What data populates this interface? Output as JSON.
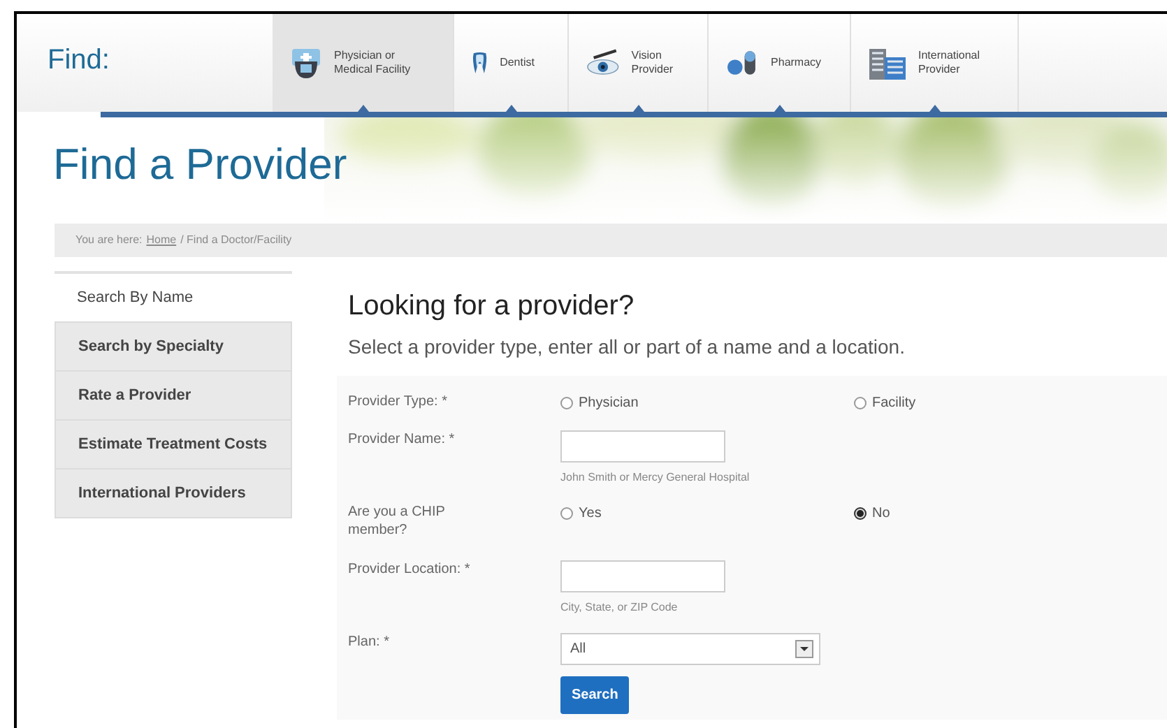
{
  "header": {
    "label": "Find:"
  },
  "provider_tabs": [
    {
      "label": "Physician or Medical Facility",
      "kind": "physician",
      "selected": true
    },
    {
      "label": "Dentist",
      "kind": "dentist",
      "selected": false
    },
    {
      "label": "Vision Provider",
      "kind": "vision",
      "selected": false
    },
    {
      "label": "Pharmacy",
      "kind": "pharmacy",
      "selected": false
    },
    {
      "label": "International Provider",
      "kind": "international",
      "selected": false
    }
  ],
  "page_title": "Find a Provider",
  "breadcrumb": {
    "prefix": "You are here:",
    "link": "Home",
    "rest": "/ Find a Doctor/Facility"
  },
  "sidebar": {
    "items": [
      {
        "label": "Search By Name",
        "selected": true
      },
      {
        "label": "Search by Specialty",
        "selected": false
      },
      {
        "label": "Rate a Provider",
        "selected": false
      },
      {
        "label": "Estimate Treatment Costs",
        "selected": false
      },
      {
        "label": "International Providers",
        "selected": false
      }
    ]
  },
  "main": {
    "heading": "Looking for a provider?",
    "subheading": "Select a provider type, enter all or part of a name and a location.",
    "rows": [
      {
        "kind": "radio",
        "label": "Provider Type: *",
        "options": [
          {
            "label": "Physician",
            "selected": false
          },
          {
            "label": "Facility",
            "selected": false
          }
        ]
      },
      {
        "kind": "text",
        "label": "Provider Name: *",
        "hint": "John Smith or Mercy General Hospital"
      },
      {
        "kind": "radio",
        "label": "Are you a CHIP member?",
        "options": [
          {
            "label": "Yes",
            "selected": false
          },
          {
            "label": "No",
            "selected": true
          }
        ]
      },
      {
        "kind": "text",
        "label": "Provider Location: *",
        "hint": "City, State, or ZIP Code"
      },
      {
        "kind": "select",
        "label": "Plan: *",
        "value": "All"
      }
    ],
    "button": "Search"
  }
}
